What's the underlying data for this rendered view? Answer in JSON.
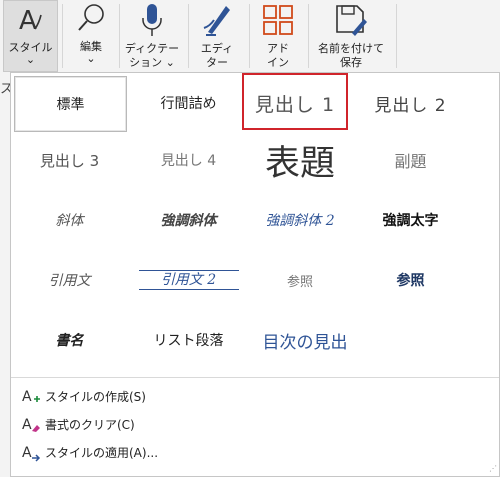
{
  "ribbon": {
    "styles_label": "スタイル",
    "styles_chevron": "⌄",
    "edit_label": "編集",
    "edit_chevron": "⌄",
    "dictation_label_line1": "ディクテー",
    "dictation_label_line2": "ション ⌄",
    "editor_label_line1": "エディ",
    "editor_label_line2": "ター",
    "addin_label_line1": "アド",
    "addin_label_line2": "イン",
    "save_label_line1": "名前を付けて",
    "save_label_line2": "保存"
  },
  "edge_char": "ス",
  "styles": [
    {
      "label": "標準"
    },
    {
      "label": "行間詰め"
    },
    {
      "label": "見出し 1"
    },
    {
      "label": "見出し 2"
    },
    {
      "label": "見出し 3"
    },
    {
      "label": "見出し 4"
    },
    {
      "label": "表題"
    },
    {
      "label": "副題"
    },
    {
      "label": "斜体"
    },
    {
      "label": "強調斜体"
    },
    {
      "label": "強調斜体 2"
    },
    {
      "label": "強調太字"
    },
    {
      "label": "引用文"
    },
    {
      "label": "引用文 2"
    },
    {
      "label": "参照"
    },
    {
      "label": "参照"
    },
    {
      "label": "書名"
    },
    {
      "label": "リスト段落"
    },
    {
      "label": "目次の見出"
    }
  ],
  "menu": {
    "create_style": "スタイルの作成(S)",
    "clear_format": "書式のクリア(C)",
    "apply_styles": "スタイルの適用(A)..."
  },
  "colors": {
    "accent_blue": "#2f5496",
    "heading_blue": "#1f3864",
    "highlight_red": "#d0242b",
    "gray_text": "#767676"
  }
}
